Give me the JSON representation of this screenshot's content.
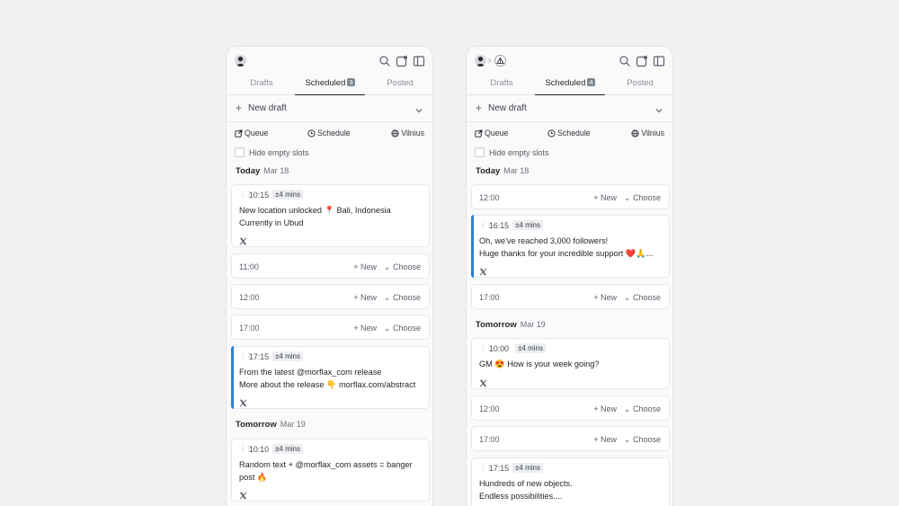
{
  "icons": {
    "search": "search-icon",
    "compose": "compose-icon",
    "sidebar": "sidebar-toggle-icon",
    "queue": "external-link-icon",
    "schedule": "clock-icon",
    "timezone": "globe-icon",
    "platform": "x-logo-icon"
  },
  "colors": {
    "accent": "#2f7fd4",
    "badge": "#7d8590",
    "background": "#f0f1f3"
  },
  "panels": [
    {
      "tabs": {
        "drafts": "Drafts",
        "scheduled": "Scheduled",
        "scheduled_count": "3",
        "posted": "Posted"
      },
      "new_draft": "New draft",
      "toolbar": {
        "queue": "Queue",
        "schedule": "Schedule",
        "timezone": "Vilnius"
      },
      "hide_empty": "Hide empty slots",
      "today": {
        "title": "Today",
        "date": "Mar 18"
      },
      "tomorrow": {
        "title": "Tomorrow",
        "date": "Mar 19"
      },
      "posts": [
        {
          "time": "10:15",
          "tol": "±4 mins",
          "line1": "New location unlocked 📍 Bali, Indonesia",
          "line2": "Currently in Ubud"
        },
        {
          "time": "17:15",
          "tol": "±4 mins",
          "line1": "From the latest @morflax_com release",
          "line2": "More about the release 👇 morflax.com/abstract"
        },
        {
          "time": "10:10",
          "tol": "±4 mins",
          "line1": "Random text + @morflax_com assets = banger",
          "line2": "post 🔥"
        }
      ],
      "slots": [
        {
          "time": "11:00",
          "new": "New",
          "choose": "Choose"
        },
        {
          "time": "12:00",
          "new": "New",
          "choose": "Choose"
        },
        {
          "time": "17:00",
          "new": "New",
          "choose": "Choose"
        }
      ]
    },
    {
      "tabs": {
        "drafts": "Drafts",
        "scheduled": "Scheduled",
        "scheduled_count": "4",
        "posted": "Posted"
      },
      "new_draft": "New draft",
      "toolbar": {
        "queue": "Queue",
        "schedule": "Schedule",
        "timezone": "Vilnius"
      },
      "hide_empty": "Hide empty slots",
      "today": {
        "title": "Today",
        "date": "Mar 18"
      },
      "tomorrow": {
        "title": "Tomorrow",
        "date": "Mar 19"
      },
      "posts": [
        {
          "time": "16:15",
          "tol": "±4 mins",
          "line1": "Oh, we've reached 3,000 followers!",
          "line2": "Huge thanks for your incredible support ❤️🙏..."
        },
        {
          "time": "10:00",
          "tol": "±4 mins",
          "line1": "GM 😍 How is your week going?",
          "line2": ""
        },
        {
          "time": "17:15",
          "tol": "±4 mins",
          "line1": "Hundreds of new objects.",
          "line2": "Endless possibilities...."
        }
      ],
      "slots": [
        {
          "time": "12:00",
          "new": "New",
          "choose": "Choose"
        },
        {
          "time": "17:00",
          "new": "New",
          "choose": "Choose"
        },
        {
          "time": "12:00",
          "new": "New",
          "choose": "Choose"
        },
        {
          "time": "17:00",
          "new": "New",
          "choose": "Choose"
        }
      ]
    }
  ]
}
